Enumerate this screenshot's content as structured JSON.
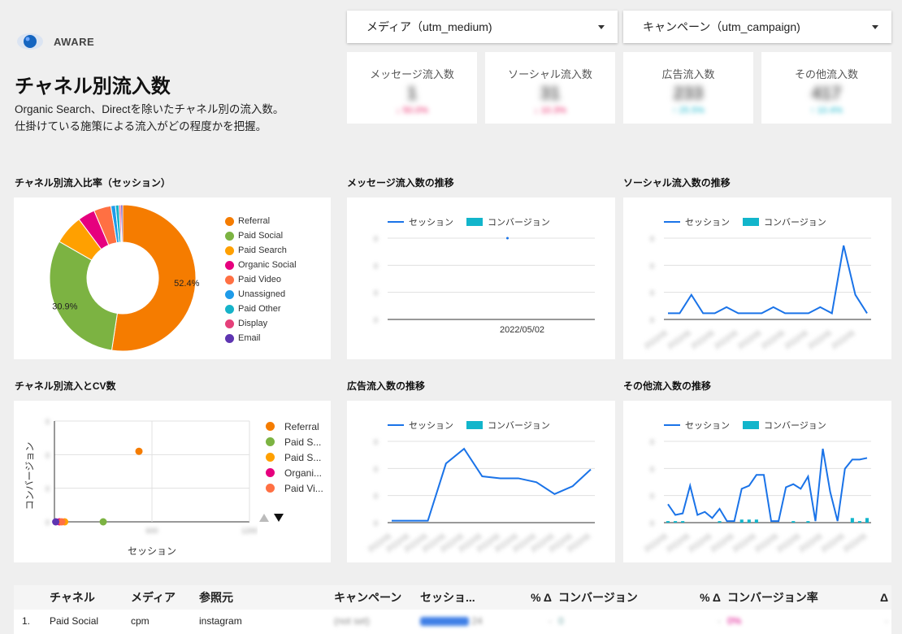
{
  "brand": {
    "name": "AWARE"
  },
  "page": {
    "title": "チャネル別流入数",
    "desc_line1": "Organic Search、Directを除いたチャネル別の流入数。",
    "desc_line2": "仕掛けている施策による流入がどの程度かを把握。"
  },
  "filters": {
    "medium": "メディア（utm_medium)",
    "campaign": "キャンペーン（utm_campaign)"
  },
  "kpis": [
    {
      "label": "メッセージ流入数",
      "value": "1",
      "delta": "↓ 50.0%",
      "color": "#e91e63"
    },
    {
      "label": "ソーシャル流入数",
      "value": "31",
      "delta": "↓ 10.3%",
      "color": "#e91e63"
    },
    {
      "label": "広告流入数",
      "value": "233",
      "delta": "↑ 25.5%",
      "color": "#12b5cb"
    },
    {
      "label": "その他流入数",
      "value": "417",
      "delta": "↑ 10.4%",
      "color": "#12b5cb"
    }
  ],
  "sections": {
    "pie": "チャネル別流入比率（セッション）",
    "msg": "メッセージ流入数の推移",
    "social": "ソーシャル流入数の推移",
    "scatter": "チャネル別流入とCV数",
    "ad": "広告流入数の推移",
    "other": "その他流入数の推移"
  },
  "legend": {
    "sessions": "セッション",
    "conversions": "コンバージョン"
  },
  "msg_xlabel": "2022/05/02",
  "scatter_axes": {
    "x": "セッション",
    "y": "コンバージョン"
  },
  "colors": {
    "referral": "#f57c00",
    "paid_social": "#7cb342",
    "paid_search": "#ffa000",
    "organic_social": "#e6007e",
    "paid_video": "#ff7043",
    "unassigned": "#1e9be9",
    "paid_other": "#16b3c9",
    "display": "#e5407a",
    "email": "#5e35b1",
    "line": "#1a73e8",
    "bar": "#12b5cb"
  },
  "chart_data": [
    {
      "type": "pie",
      "title": "チャネル別流入比率（セッション）",
      "categories": [
        "Referral",
        "Paid Social",
        "Paid Search",
        "Organic Social",
        "Paid Video",
        "Unassigned",
        "Paid Other",
        "Display",
        "Email"
      ],
      "values": [
        52.4,
        30.9,
        6.5,
        3.8,
        3.8,
        1.0,
        0.8,
        0.4,
        0.4
      ],
      "data_labels": [
        "52.4%",
        "30.9%"
      ],
      "legend": "right"
    },
    {
      "type": "line",
      "title": "メッセージ流入数の推移",
      "x": [
        "2022/05/02"
      ],
      "series": [
        {
          "name": "セッション",
          "values": [
            1
          ]
        },
        {
          "name": "コンバージョン",
          "values": [
            0
          ]
        }
      ]
    },
    {
      "type": "line",
      "title": "ソーシャル流入数の推移",
      "series": [
        {
          "name": "セッション",
          "values": [
            1,
            1,
            4,
            1,
            1,
            2,
            1,
            1,
            1,
            2,
            1,
            1,
            1,
            2,
            1,
            12,
            4,
            1
          ]
        },
        {
          "name": "コンバージョン",
          "values": [
            0,
            0,
            0,
            0,
            0,
            0,
            0,
            0,
            0,
            0,
            0,
            0,
            0,
            0,
            0,
            0,
            0,
            0
          ]
        }
      ]
    },
    {
      "type": "scatter",
      "title": "チャネル別流入とCV数",
      "xlabel": "セッション",
      "ylabel": "コンバージョン",
      "series": [
        {
          "name": "Referral",
          "x": 520,
          "y": 0.7
        },
        {
          "name": "Paid Social",
          "x": 300,
          "y": 0
        },
        {
          "name": "Paid Search",
          "x": 63,
          "y": 0
        },
        {
          "name": "Organic Social",
          "x": 31,
          "y": 0
        },
        {
          "name": "Paid Video",
          "x": 45,
          "y": 0
        },
        {
          "name": "Email",
          "x": 8,
          "y": 0
        }
      ],
      "legend_entries": [
        "Referral",
        "Paid S...",
        "Paid S...",
        "Organi...",
        "Paid Vi..."
      ],
      "xlim": [
        0,
        1200
      ],
      "ylim": [
        0,
        1
      ]
    },
    {
      "type": "line",
      "title": "広告流入数の推移",
      "series": [
        {
          "name": "セッション",
          "values": [
            2,
            2,
            2,
            60,
            75,
            47,
            45,
            45,
            41,
            29,
            37,
            54
          ]
        },
        {
          "name": "コンバージョン",
          "values": [
            0,
            0,
            0,
            0,
            0,
            0,
            0,
            0,
            0,
            0,
            0,
            0
          ]
        }
      ]
    },
    {
      "type": "line",
      "title": "その他流入数の推移",
      "series": [
        {
          "name": "セッション",
          "values": [
            12,
            5,
            6,
            24,
            5,
            7,
            3,
            9,
            1,
            1,
            22,
            24,
            31,
            31,
            1,
            1,
            23,
            25,
            22,
            30,
            1,
            48,
            20,
            1,
            35,
            41,
            41,
            42
          ]
        },
        {
          "name": "コンバージョン",
          "values": [
            1,
            1,
            1,
            0,
            0,
            0,
            0,
            1,
            0,
            0,
            2,
            2,
            2,
            0,
            0,
            0,
            0,
            1,
            0,
            1,
            0,
            0,
            0,
            0,
            0,
            3,
            1,
            3
          ]
        }
      ]
    }
  ],
  "table": {
    "headers": [
      "チャネル",
      "メディア",
      "参照元",
      "キャンペーン",
      "セッショ...",
      "% Δ",
      "コンバージョン",
      "% Δ",
      "コンバージョン率",
      "Δ"
    ],
    "rows": [
      {
        "idx": "1.",
        "channel": "Paid Social",
        "medium": "cpm",
        "source": "instagram",
        "campaign": "(not set)",
        "sessions": "24",
        "sess_delta": "-",
        "conv": "0",
        "conv_delta": "-",
        "rate": "0%",
        "rate_delta": "-"
      }
    ]
  }
}
